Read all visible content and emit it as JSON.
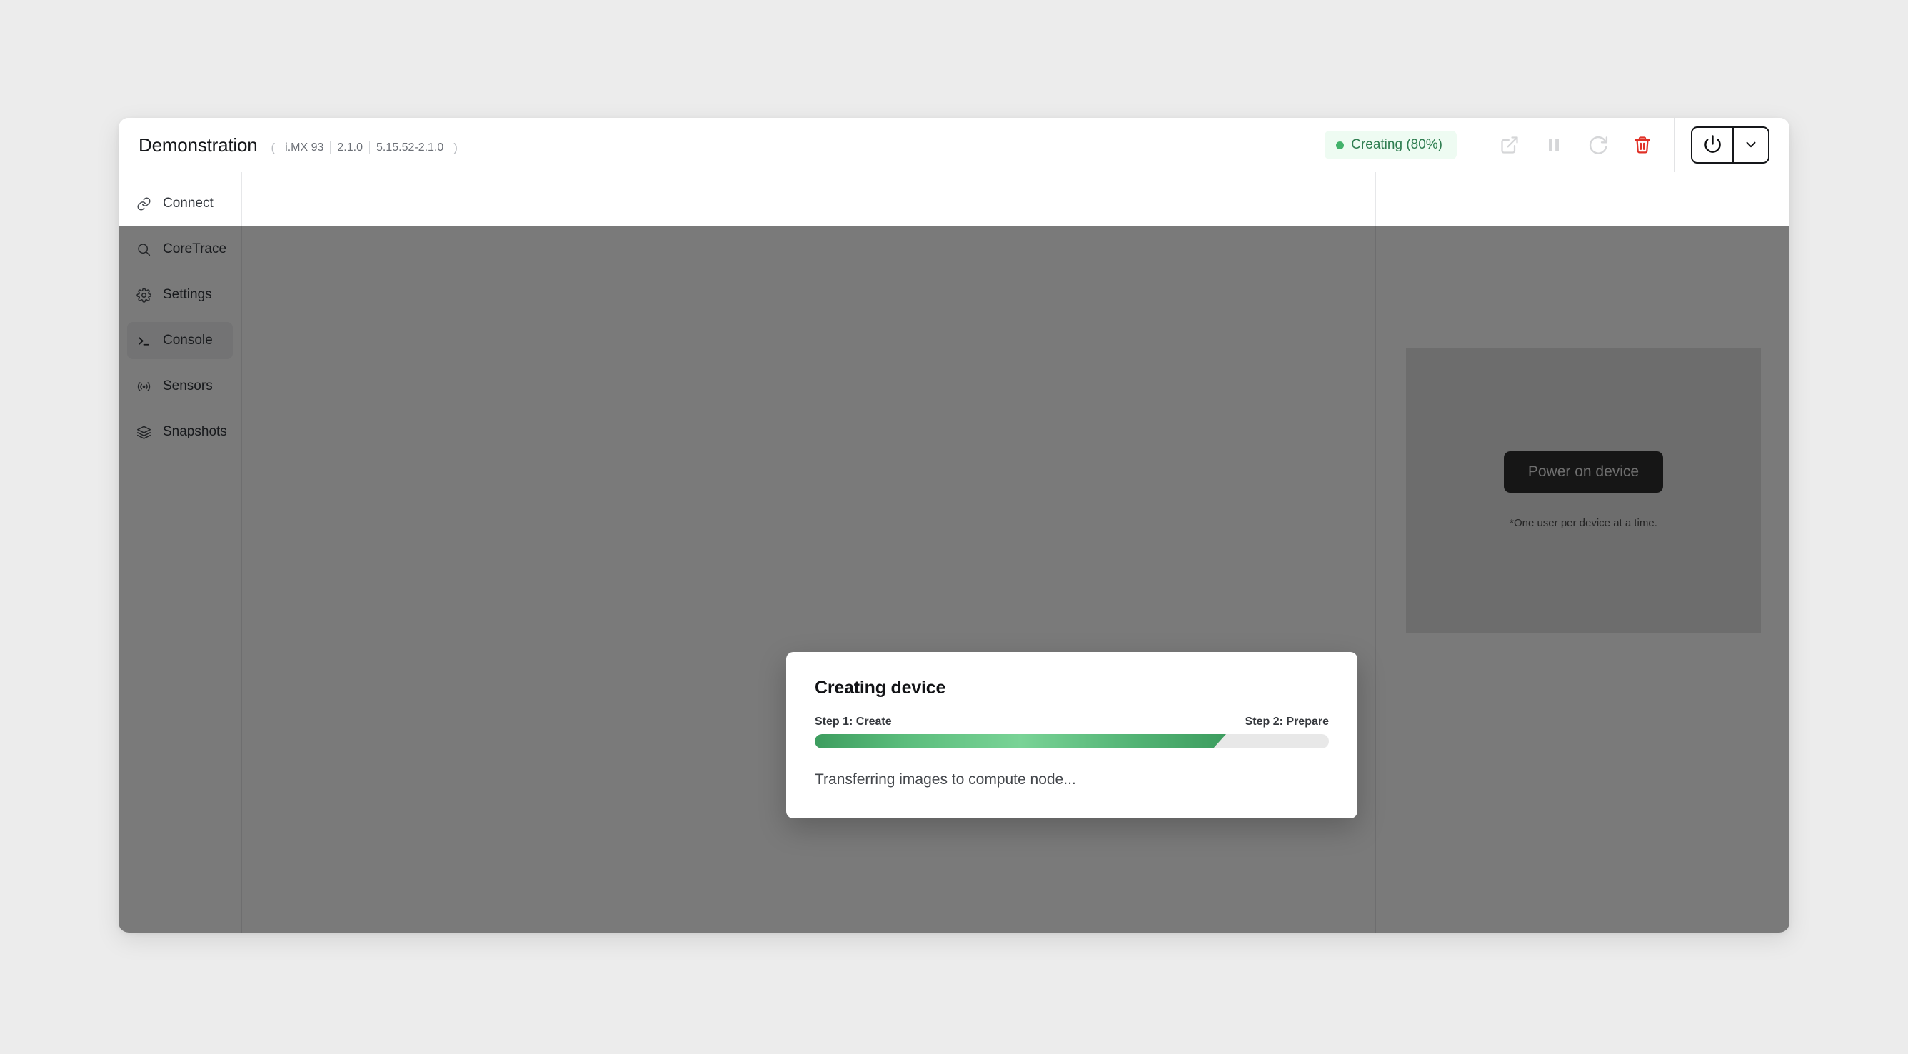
{
  "header": {
    "device_title": "Demonstration",
    "meta_open": "(",
    "meta_close": ")",
    "meta": [
      "i.MX 93",
      "2.1.0",
      "5.15.52-2.1.0"
    ],
    "status_badge": {
      "label": "Creating (80%)",
      "dot_color": "#43b26b",
      "bg_color": "#eefbf2",
      "text_color": "#2e7d50"
    },
    "toolbar": [
      {
        "name": "open-external-icon",
        "title": "Open in new window"
      },
      {
        "name": "pause-icon",
        "title": "Pause"
      },
      {
        "name": "refresh-icon",
        "title": "Refresh"
      },
      {
        "name": "delete-icon",
        "title": "Delete",
        "color": "#e03127"
      }
    ],
    "power": {
      "power_title": "Power",
      "caret_title": "Power options"
    }
  },
  "sidebar": {
    "items": [
      {
        "label": "Connect",
        "icon": "link-icon",
        "active": false
      },
      {
        "label": "CoreTrace",
        "icon": "search-icon",
        "active": false
      },
      {
        "label": "Settings",
        "icon": "gear-icon",
        "active": false
      },
      {
        "label": "Console",
        "icon": "terminal-icon",
        "active": true
      },
      {
        "label": "Sensors",
        "icon": "signal-icon",
        "active": false
      },
      {
        "label": "Snapshots",
        "icon": "layers-icon",
        "active": false
      }
    ]
  },
  "right_panel": {
    "power_on_label": "Power on device",
    "note": "*One user per device at a time."
  },
  "modal": {
    "title": "Creating device",
    "step_left": "Step 1: Create",
    "step_right": "Step 2: Prepare",
    "progress_percent": 80,
    "status_text": "Transferring images to compute node..."
  }
}
